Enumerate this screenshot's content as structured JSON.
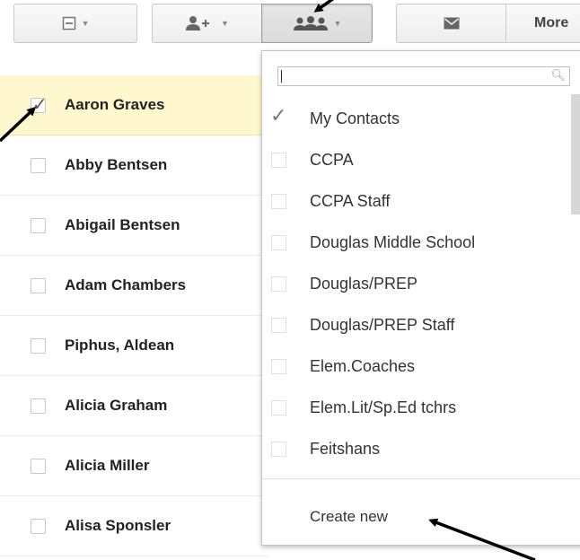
{
  "toolbar": {
    "more_label": "More"
  },
  "contacts": [
    {
      "name": "Aaron Graves",
      "checked": true
    },
    {
      "name": "Abby Bentsen",
      "checked": false
    },
    {
      "name": "Abigail Bentsen",
      "checked": false
    },
    {
      "name": "Adam Chambers",
      "checked": false
    },
    {
      "name": "Piphus, Aldean",
      "checked": false
    },
    {
      "name": "Alicia Graham",
      "checked": false
    },
    {
      "name": "Alicia Miller",
      "checked": false
    },
    {
      "name": "Alisa Sponsler",
      "checked": false
    }
  ],
  "groups_dropdown": {
    "search_value": "",
    "groups": [
      {
        "label": "My Contacts",
        "checked": true
      },
      {
        "label": "CCPA",
        "checked": false
      },
      {
        "label": "CCPA Staff",
        "checked": false
      },
      {
        "label": "Douglas Middle School",
        "checked": false
      },
      {
        "label": "Douglas/PREP",
        "checked": false
      },
      {
        "label": "Douglas/PREP Staff",
        "checked": false
      },
      {
        "label": "Elem.Coaches",
        "checked": false
      },
      {
        "label": "Elem.Lit/Sp.Ed tchrs",
        "checked": false
      },
      {
        "label": "Feitshans",
        "checked": false
      }
    ],
    "create_new_label": "Create new"
  },
  "colors": {
    "selected_row": "#fff8cf",
    "annotation_arrow": "#000000"
  }
}
